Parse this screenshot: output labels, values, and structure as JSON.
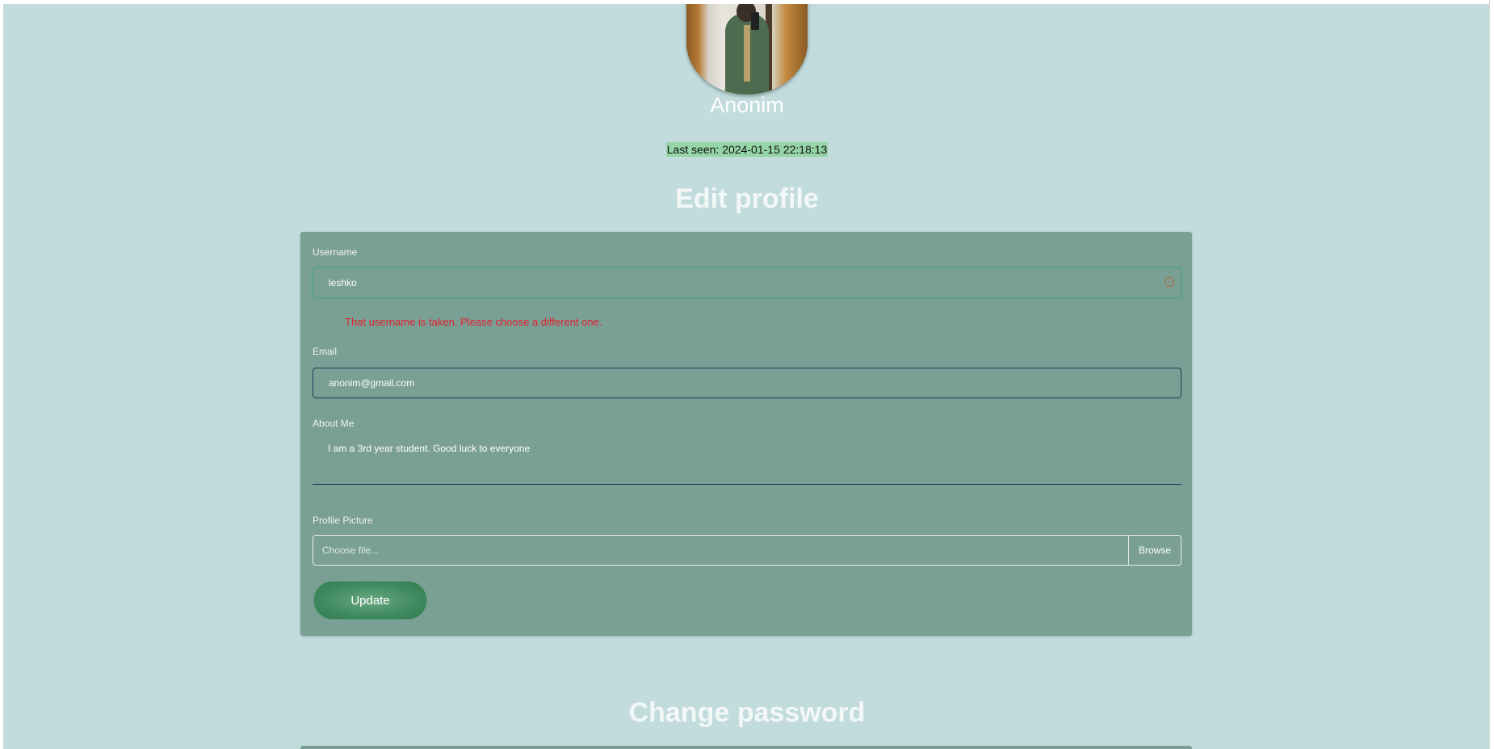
{
  "profile": {
    "display_name": "Anonim",
    "last_seen": "Last seen: 2024-01-15 22:18:13"
  },
  "edit_profile": {
    "title": "Edit profile",
    "username_label": "Username",
    "username_value": "leshko",
    "username_error": "That username is taken. Please choose a different one.",
    "email_label": "Email",
    "email_value": "anonim@gmail.com",
    "about_label": "About Me",
    "about_value": "I am a 3rd year student. Good luck to everyone",
    "picture_label": "Profile Picture",
    "file_placeholder": "Choose file...",
    "browse_label": "Browse",
    "update_label": "Update"
  },
  "change_password": {
    "title": "Change password"
  },
  "colors": {
    "page_bg": "#c2dcdd",
    "card_bg": "#7a9f94",
    "error": "#e0232f",
    "last_seen_highlight": "#95d5a8",
    "button": "#3f8a5f"
  }
}
